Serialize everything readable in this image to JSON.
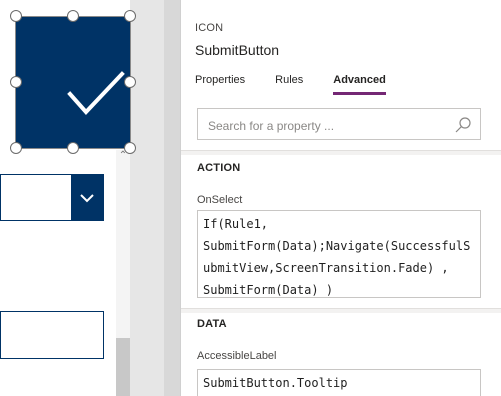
{
  "panel": {
    "control_type": "ICON",
    "control_name": "SubmitButton",
    "tabs": [
      {
        "label": "Properties",
        "active": false
      },
      {
        "label": "Rules",
        "active": false
      },
      {
        "label": "Advanced",
        "active": true
      }
    ],
    "search": {
      "placeholder": "Search for a property ..."
    },
    "sections": [
      {
        "title": "ACTION",
        "property": "OnSelect",
        "formula": "If(Rule1,\nSubmitForm(Data);Navigate(SuccessfulSubmitView,ScreenTransition.Fade) ,\nSubmitForm(Data) )"
      },
      {
        "title": "DATA",
        "property": "AccessibleLabel",
        "formula": "SubmitButton.Tooltip"
      }
    ]
  },
  "canvas": {
    "selected_icon": "check-icon",
    "icon_fill": "#003366",
    "dropdown_icon": "chevron-down-icon"
  },
  "colors": {
    "accent": "#742774",
    "control_fill": "#003366"
  }
}
